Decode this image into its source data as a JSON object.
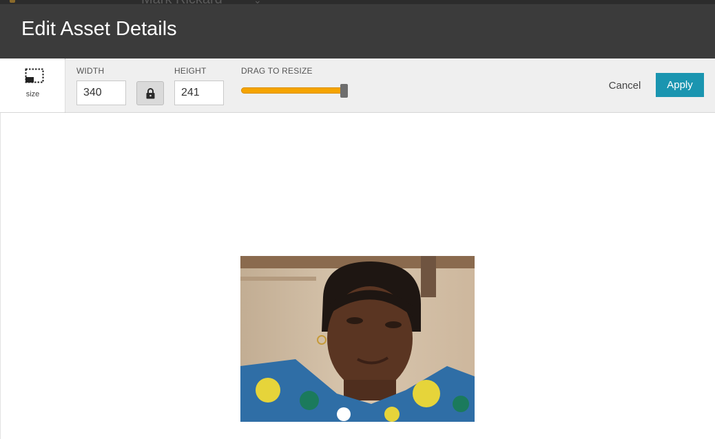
{
  "backdrop": {
    "title": "Mark Rickard",
    "chevron_icon": "chevron-down-icon"
  },
  "modal": {
    "title": "Edit Asset Details"
  },
  "toolbar": {
    "size_tool": {
      "label": "size",
      "icon": "resize-frame-icon"
    },
    "width": {
      "label": "WIDTH",
      "value": "340"
    },
    "lock": {
      "icon": "lock-icon",
      "locked": true
    },
    "height": {
      "label": "HEIGHT",
      "value": "241"
    },
    "slider": {
      "label": "DRAG TO RESIZE",
      "fraction": 1.0
    },
    "cancel_label": "Cancel",
    "apply_label": "Apply"
  },
  "colors": {
    "header": "#3b3b3b",
    "toolbar": "#efefef",
    "accent": "#1a95b0",
    "slider_fill": "#f5a400"
  },
  "preview": {
    "image": "photo-portrait-girl"
  }
}
